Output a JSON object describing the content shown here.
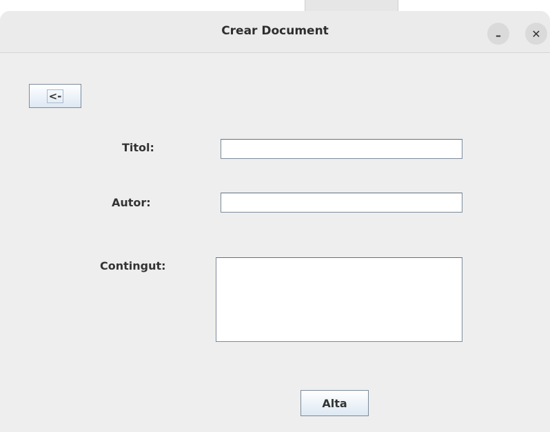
{
  "window": {
    "title": "Crear Document",
    "minimize_glyph": "–",
    "close_glyph": "✕"
  },
  "form": {
    "back_label": "<-",
    "titol_label": "Titol:",
    "titol_value": "",
    "autor_label": "Autor:",
    "autor_value": "",
    "contingut_label": "Contingut:",
    "contingut_value": "",
    "submit_label": "Alta"
  }
}
